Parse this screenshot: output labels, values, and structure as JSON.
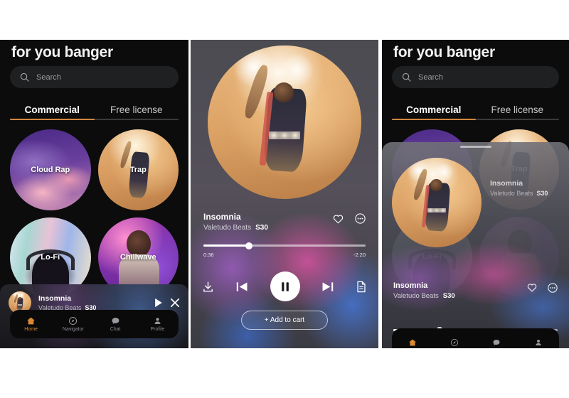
{
  "app": {
    "title": "for you banger",
    "accent_orange": "#d1873f",
    "track": {
      "title": "Insomnia",
      "artist": "Valetudo Beats",
      "price": "S30"
    },
    "time": {
      "elapsed": "0:36",
      "remaining": "-2:20",
      "progress_percent": 28
    }
  },
  "search": {
    "placeholder": "Search",
    "icon": "search-icon"
  },
  "tabs": [
    {
      "label": "Commercial",
      "active": true
    },
    {
      "label": "Free license",
      "active": false
    }
  ],
  "genres": [
    {
      "label": "Cloud Rap"
    },
    {
      "label": "Trap"
    },
    {
      "label": "Lo-Fi"
    },
    {
      "label": "Chillwave"
    }
  ],
  "mini_player": {
    "play_icon": "play-icon",
    "close_icon": "close-icon",
    "thumbnail": "album-thumbnail"
  },
  "bottom_nav": [
    {
      "label": "Home",
      "icon": "home-icon",
      "active": true
    },
    {
      "label": "Navigator",
      "icon": "compass-icon",
      "active": false
    },
    {
      "label": "Chat",
      "icon": "chat-bubble-icon",
      "active": false
    },
    {
      "label": "Profile",
      "icon": "person-icon",
      "active": false
    }
  ],
  "player": {
    "like_icon": "heart-icon",
    "more_icon": "more-options-icon",
    "download_icon": "download-icon",
    "previous_icon": "previous-track-icon",
    "pause_icon": "pause-icon",
    "next_icon": "next-track-icon",
    "license_icon": "document-icon",
    "add_to_cart_label": "+ Add to cart"
  }
}
